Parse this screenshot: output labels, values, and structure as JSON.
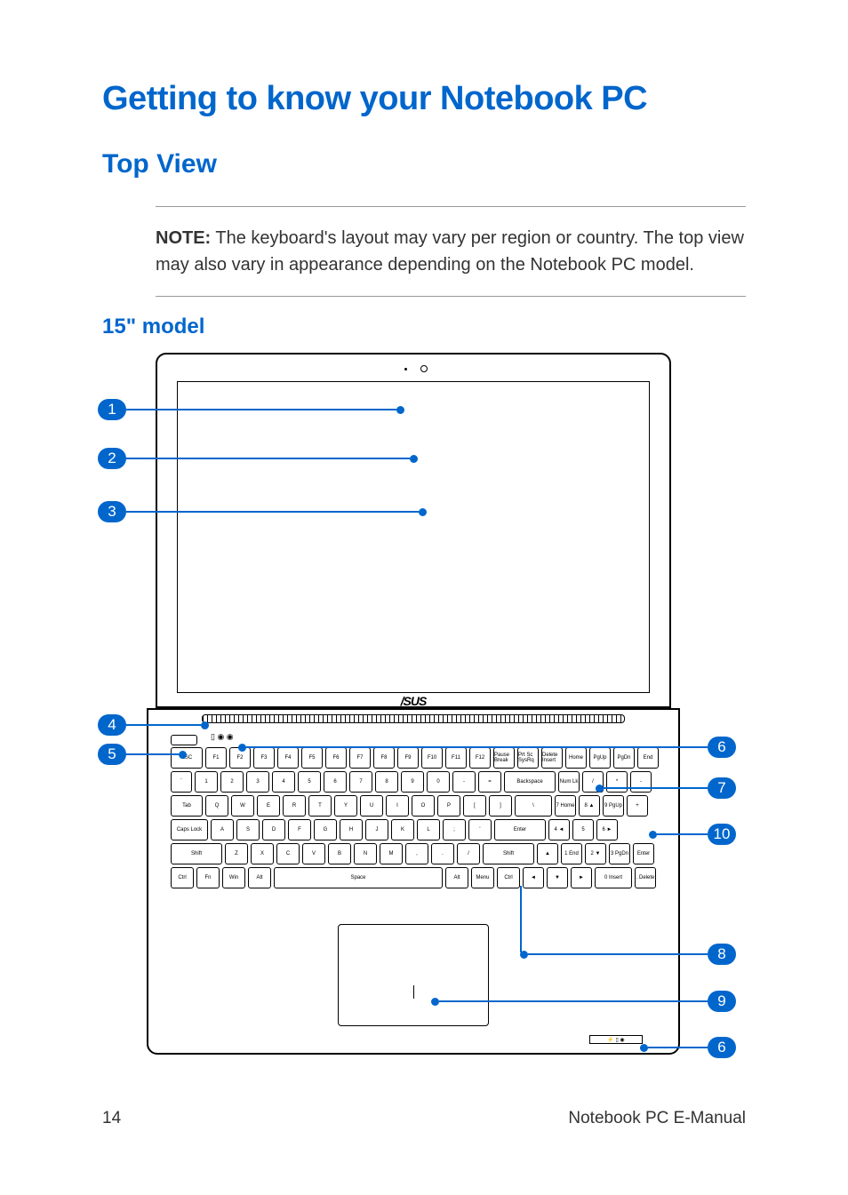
{
  "main_title": "Getting to know your Notebook PC",
  "section_title": "Top View",
  "note": {
    "label": "NOTE:",
    "text": " The keyboard's layout may vary per region or country. The top view may also vary in appearance depending on the Notebook PC model."
  },
  "subsection_title": "15\" model",
  "brand": "/SUS",
  "callouts": {
    "c1": "1",
    "c2": "2",
    "c3": "3",
    "c4": "4",
    "c5": "5",
    "c6": "6",
    "c7": "7",
    "c8": "8",
    "c9": "9",
    "c10": "10"
  },
  "keyboard": {
    "row1": [
      "ESC",
      "F1",
      "F2",
      "F3",
      "F4",
      "F5",
      "F6",
      "F7",
      "F8",
      "F9",
      "F10",
      "F11",
      "F12",
      "Pause Break",
      "Prt Sc SysRq",
      "Delete Insert",
      "Home",
      "PgUp",
      "PgDn",
      "End"
    ],
    "row2": [
      "`",
      "1",
      "2",
      "3",
      "4",
      "5",
      "6",
      "7",
      "8",
      "9",
      "0",
      "-",
      "=",
      "Backspace",
      "Num Lk",
      "/",
      "*",
      "-"
    ],
    "row3": [
      "Tab",
      "Q",
      "W",
      "E",
      "R",
      "T",
      "Y",
      "U",
      "I",
      "O",
      "P",
      "[",
      "]",
      "\\",
      "7 Home",
      "8 ▲",
      "9 PgUp",
      "+"
    ],
    "row4": [
      "Caps Lock",
      "A",
      "S",
      "D",
      "F",
      "G",
      "H",
      "J",
      "K",
      "L",
      ";",
      "'",
      "Enter",
      "4 ◄",
      "5",
      "6 ►"
    ],
    "row5": [
      "Shift",
      "Z",
      "X",
      "C",
      "V",
      "B",
      "N",
      "M",
      ",",
      ".",
      "/",
      "Shift",
      "▲",
      "1 End",
      "2 ▼",
      "3 PgDn",
      "Enter"
    ],
    "row6": [
      "Ctrl",
      "Fn",
      "Win",
      "Alt",
      "Space",
      "Alt",
      "Menu",
      "Ctrl",
      "◄",
      "▼",
      "►",
      "0 Insert",
      ". Delete"
    ]
  },
  "footer": {
    "page": "14",
    "text": "Notebook PC E-Manual"
  }
}
